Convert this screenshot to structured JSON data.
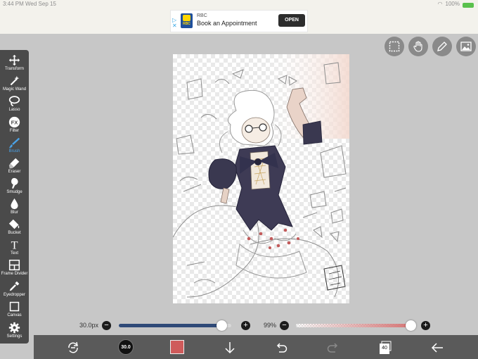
{
  "status_bar": {
    "time": "3:44 PM   Wed Sep 15",
    "battery": "100%"
  },
  "ad": {
    "brand": "RBC",
    "logo_text": "RBC",
    "title": "Book an Appointment",
    "button": "OPEN",
    "marks": "▷\n✕"
  },
  "tools": [
    {
      "id": "transform",
      "label": "Transform",
      "icon": "move-icon"
    },
    {
      "id": "magic-wand",
      "label": "Magic Wand",
      "icon": "magic-wand-icon"
    },
    {
      "id": "lasso",
      "label": "Lasso",
      "icon": "lasso-icon"
    },
    {
      "id": "filter",
      "label": "Filter",
      "icon": "fx-icon",
      "glyph": "FX"
    },
    {
      "id": "brush",
      "label": "Brush",
      "icon": "brush-icon",
      "active": true
    },
    {
      "id": "eraser",
      "label": "Eraser",
      "icon": "eraser-icon"
    },
    {
      "id": "smudge",
      "label": "Smudge",
      "icon": "smudge-icon"
    },
    {
      "id": "blur",
      "label": "Blur",
      "icon": "drop-icon"
    },
    {
      "id": "bucket",
      "label": "Bucket",
      "icon": "bucket-icon"
    },
    {
      "id": "text",
      "label": "Text",
      "icon": "text-icon",
      "glyph": "T"
    },
    {
      "id": "frame-divider",
      "label": "Frame Divider",
      "icon": "frame-divider-icon"
    },
    {
      "id": "eyedropper",
      "label": "Eyedropper",
      "icon": "eyedropper-icon"
    },
    {
      "id": "canvas",
      "label": "Canvas",
      "icon": "canvas-icon"
    },
    {
      "id": "settings",
      "label": "Settings",
      "icon": "gear-icon"
    }
  ],
  "brush_size": {
    "label": "30.0px",
    "minus": "−",
    "plus": "+",
    "fraction": 0.91,
    "color": "#2f4a78"
  },
  "opacity": {
    "label": "99%",
    "minus": "−",
    "plus": "+",
    "fraction": 0.99,
    "color": "#d47575"
  },
  "bottom_bar": {
    "brush_badge": "30.0",
    "layers_count": "40",
    "color_swatch": "#cf5b5b"
  },
  "accent_color": "#4aa3e8"
}
